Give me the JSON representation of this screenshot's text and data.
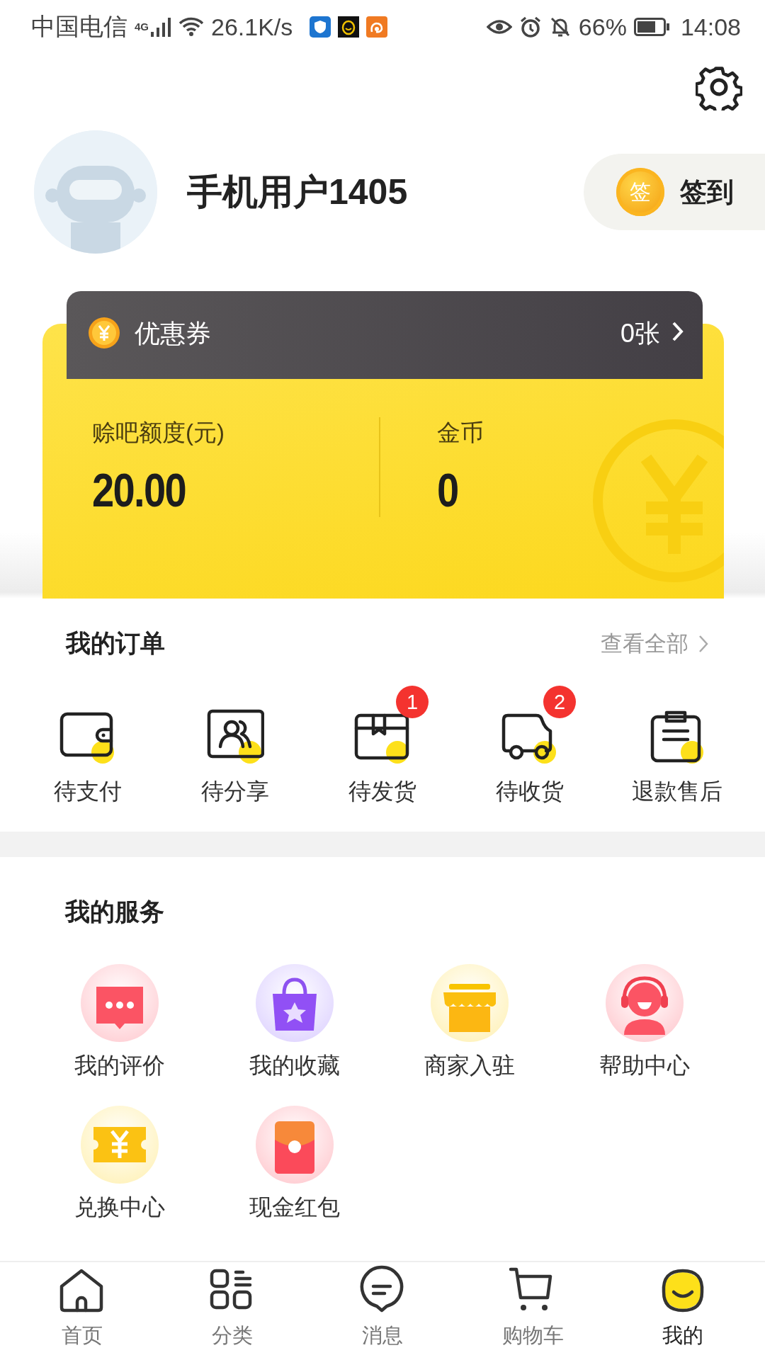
{
  "status_bar": {
    "carrier": "中国电信",
    "network": "4G",
    "speed": "26.1K/s",
    "battery": "66%",
    "time": "14:08"
  },
  "profile": {
    "name": "手机用户1405",
    "checkin_badge": "签",
    "checkin_label": "签到"
  },
  "wallet": {
    "coupon_label": "优惠券",
    "coupon_count": "0张",
    "stats": [
      {
        "label": "赊吧额度(元)",
        "value": "20.00"
      },
      {
        "label": "金币",
        "value": "0"
      }
    ]
  },
  "orders": {
    "title": "我的订单",
    "view_all": "查看全部",
    "items": [
      {
        "kind": "wallet",
        "label": "待支付"
      },
      {
        "kind": "share",
        "label": "待分享"
      },
      {
        "kind": "package",
        "label": "待发货",
        "badge": "1"
      },
      {
        "kind": "truck",
        "label": "待收货",
        "badge": "2"
      },
      {
        "kind": "clipboard",
        "label": "退款售后"
      }
    ]
  },
  "services": {
    "title": "我的服务",
    "items": [
      {
        "kind": "review",
        "label": "我的评价"
      },
      {
        "kind": "favorite",
        "label": "我的收藏"
      },
      {
        "kind": "merchant",
        "label": "商家入驻"
      },
      {
        "kind": "help",
        "label": "帮助中心"
      },
      {
        "kind": "exchange",
        "label": "兑换中心"
      },
      {
        "kind": "redpacket",
        "label": "现金红包"
      }
    ]
  },
  "tabs": [
    {
      "kind": "home",
      "label": "首页",
      "selected": false
    },
    {
      "kind": "category",
      "label": "分类",
      "selected": false
    },
    {
      "kind": "message",
      "label": "消息",
      "selected": false
    },
    {
      "kind": "cart",
      "label": "购物车",
      "selected": false
    },
    {
      "kind": "me",
      "label": "我的",
      "selected": true
    }
  ]
}
